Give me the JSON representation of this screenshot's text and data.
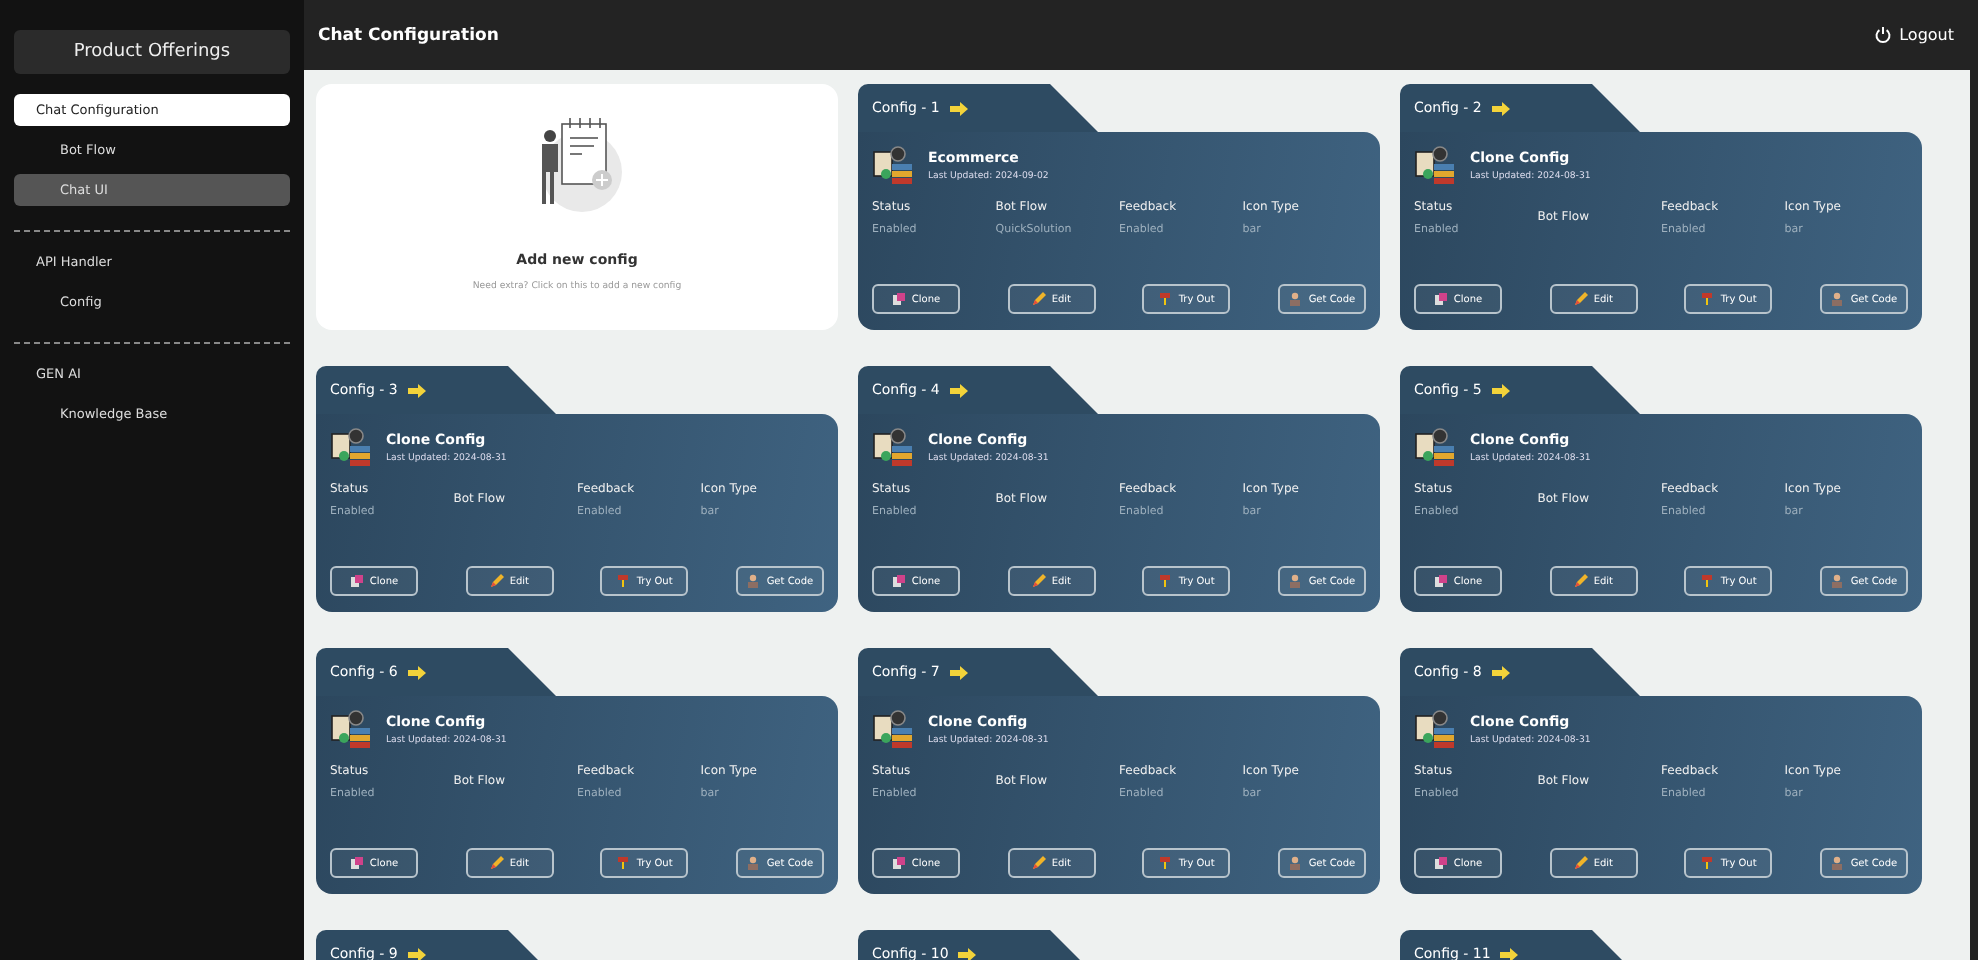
{
  "sidebar": {
    "title": "Product Offerings",
    "groups": [
      {
        "label": "Chat Configuration",
        "selected": true,
        "children": [
          {
            "label": "Bot Flow",
            "selected": false
          },
          {
            "label": "Chat UI",
            "selected": true
          }
        ]
      },
      {
        "label": "API Handler",
        "selected": false,
        "children": [
          {
            "label": "Config",
            "selected": false
          }
        ]
      },
      {
        "label": "GEN AI",
        "selected": false,
        "children": [
          {
            "label": "Knowledge Base",
            "selected": false
          }
        ]
      }
    ]
  },
  "header": {
    "title": "Chat Configuration",
    "logout": "Logout"
  },
  "add_card": {
    "title": "Add new config",
    "subtitle": "Need extra? Click on this to add a new config"
  },
  "configs": [
    {
      "tab": "Config - 1",
      "name": "Ecommerce",
      "updated": "Last Updated: 2024-09-02",
      "fields": [
        {
          "label": "Status",
          "value": "Enabled"
        },
        {
          "label": "Bot Flow",
          "value": "QuickSolution"
        },
        {
          "label": "Feedback",
          "value": "Enabled"
        },
        {
          "label": "Icon Type",
          "value": "bar"
        }
      ],
      "buttons": [
        {
          "kind": "clone",
          "label": "Clone"
        },
        {
          "kind": "edit",
          "label": "Edit"
        },
        {
          "kind": "try",
          "label": "Try Out"
        },
        {
          "kind": "code",
          "label": "Get Code"
        }
      ]
    },
    {
      "tab": "Config - 2",
      "name": "Clone Config",
      "updated": "Last Updated: 2024-08-31",
      "fields": [
        {
          "label": "Status",
          "value": "Enabled"
        },
        {
          "label": "Bot Flow"
        },
        {
          "label": "Feedback",
          "value": "Enabled"
        },
        {
          "label": "Icon Type",
          "value": "bar"
        }
      ],
      "buttons": [
        {
          "kind": "clone",
          "label": "Clone"
        },
        {
          "kind": "edit",
          "label": "Edit"
        },
        {
          "kind": "try",
          "label": "Try Out"
        },
        {
          "kind": "code",
          "label": "Get Code"
        }
      ]
    },
    {
      "tab": "Config - 3",
      "name": "Clone Config",
      "updated": "Last Updated: 2024-08-31",
      "fields": [
        {
          "label": "Status",
          "value": "Enabled"
        },
        {
          "label": "Bot Flow"
        },
        {
          "label": "Feedback",
          "value": "Enabled"
        },
        {
          "label": "Icon Type",
          "value": "bar"
        }
      ],
      "buttons": [
        {
          "kind": "clone",
          "label": "Clone"
        },
        {
          "kind": "edit",
          "label": "Edit"
        },
        {
          "kind": "try",
          "label": "Try Out"
        },
        {
          "kind": "code",
          "label": "Get Code"
        }
      ]
    },
    {
      "tab": "Config - 4",
      "name": "Clone Config",
      "updated": "Last Updated: 2024-08-31",
      "fields": [
        {
          "label": "Status",
          "value": "Enabled"
        },
        {
          "label": "Bot Flow"
        },
        {
          "label": "Feedback",
          "value": "Enabled"
        },
        {
          "label": "Icon Type",
          "value": "bar"
        }
      ],
      "buttons": [
        {
          "kind": "clone",
          "label": "Clone"
        },
        {
          "kind": "edit",
          "label": "Edit"
        },
        {
          "kind": "try",
          "label": "Try Out"
        },
        {
          "kind": "code",
          "label": "Get Code"
        }
      ]
    },
    {
      "tab": "Config - 5",
      "name": "Clone Config",
      "updated": "Last Updated: 2024-08-31",
      "fields": [
        {
          "label": "Status",
          "value": "Enabled"
        },
        {
          "label": "Bot Flow"
        },
        {
          "label": "Feedback",
          "value": "Enabled"
        },
        {
          "label": "Icon Type",
          "value": "bar"
        }
      ],
      "buttons": [
        {
          "kind": "clone",
          "label": "Clone"
        },
        {
          "kind": "edit",
          "label": "Edit"
        },
        {
          "kind": "try",
          "label": "Try Out"
        },
        {
          "kind": "code",
          "label": "Get Code"
        }
      ]
    },
    {
      "tab": "Config - 6",
      "name": "Clone Config",
      "updated": "Last Updated: 2024-08-31",
      "fields": [
        {
          "label": "Status",
          "value": "Enabled"
        },
        {
          "label": "Bot Flow"
        },
        {
          "label": "Feedback",
          "value": "Enabled"
        },
        {
          "label": "Icon Type",
          "value": "bar"
        }
      ],
      "buttons": [
        {
          "kind": "clone",
          "label": "Clone"
        },
        {
          "kind": "edit",
          "label": "Edit"
        },
        {
          "kind": "try",
          "label": "Try Out"
        },
        {
          "kind": "code",
          "label": "Get Code"
        }
      ]
    },
    {
      "tab": "Config - 7",
      "name": "Clone Config",
      "updated": "Last Updated: 2024-08-31",
      "fields": [
        {
          "label": "Status",
          "value": "Enabled"
        },
        {
          "label": "Bot Flow"
        },
        {
          "label": "Feedback",
          "value": "Enabled"
        },
        {
          "label": "Icon Type",
          "value": "bar"
        }
      ],
      "buttons": [
        {
          "kind": "clone",
          "label": "Clone"
        },
        {
          "kind": "edit",
          "label": "Edit"
        },
        {
          "kind": "try",
          "label": "Try Out"
        },
        {
          "kind": "code",
          "label": "Get Code"
        }
      ]
    },
    {
      "tab": "Config - 8",
      "name": "Clone Config",
      "updated": "Last Updated: 2024-08-31",
      "fields": [
        {
          "label": "Status",
          "value": "Enabled"
        },
        {
          "label": "Bot Flow"
        },
        {
          "label": "Feedback",
          "value": "Enabled"
        },
        {
          "label": "Icon Type",
          "value": "bar"
        }
      ],
      "buttons": [
        {
          "kind": "clone",
          "label": "Clone"
        },
        {
          "kind": "edit",
          "label": "Edit"
        },
        {
          "kind": "try",
          "label": "Try Out"
        },
        {
          "kind": "code",
          "label": "Get Code"
        }
      ]
    },
    {
      "tab": "Config - 9"
    },
    {
      "tab": "Config - 10"
    },
    {
      "tab": "Config - 11"
    }
  ]
}
